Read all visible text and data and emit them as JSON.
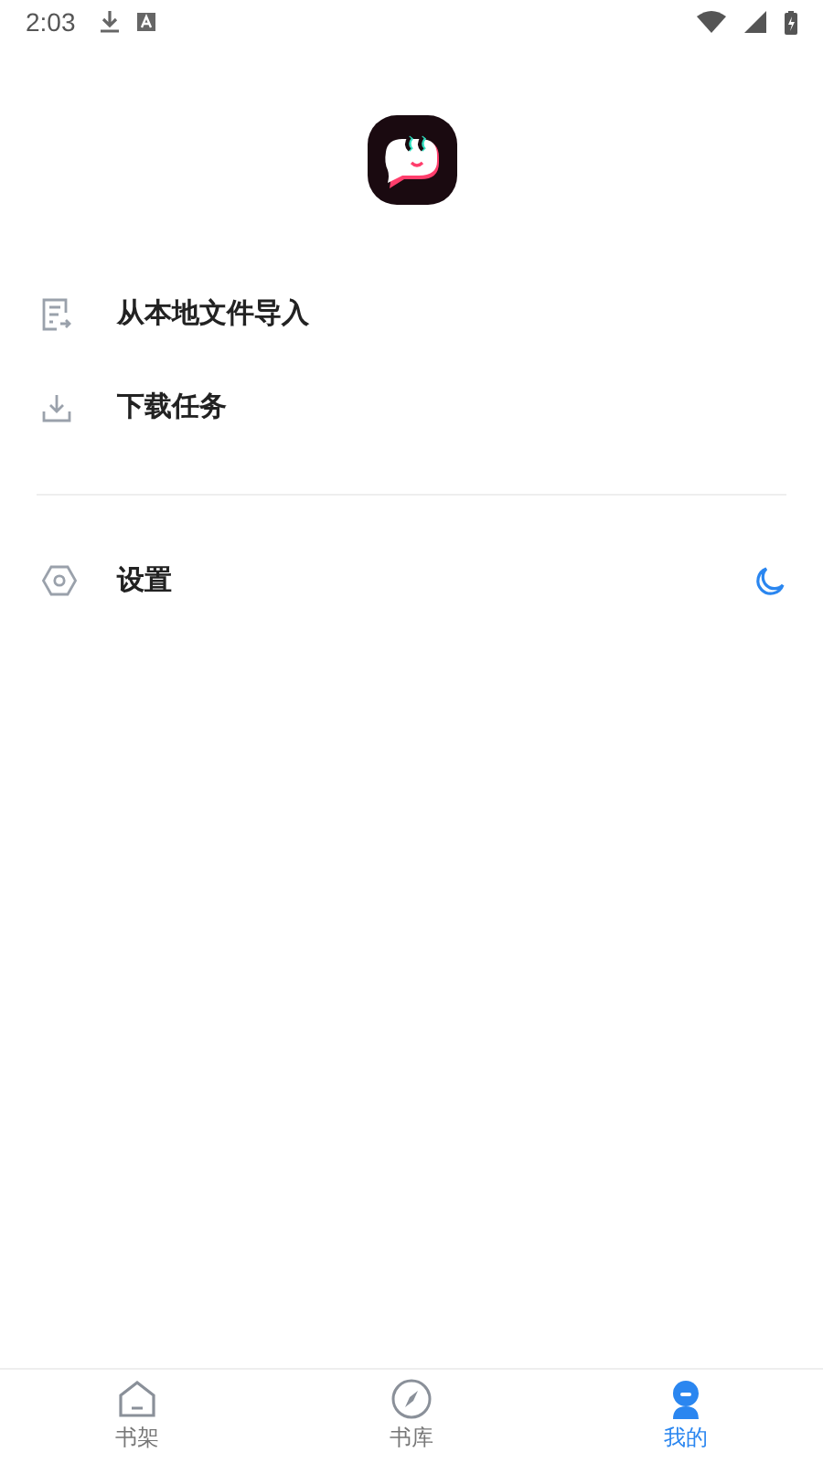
{
  "status_bar": {
    "time": "2:03"
  },
  "menu_groups": [
    [
      {
        "label": "从本地文件导入",
        "kind": "import"
      },
      {
        "label": "下载任务",
        "kind": "download"
      }
    ],
    [
      {
        "label": "设置",
        "kind": "settings"
      }
    ]
  ],
  "bottom_nav": [
    {
      "label": "书架",
      "kind": "shelf",
      "selected": false
    },
    {
      "label": "书库",
      "kind": "library",
      "selected": false
    },
    {
      "label": "我的",
      "kind": "profile",
      "selected": true
    }
  ]
}
